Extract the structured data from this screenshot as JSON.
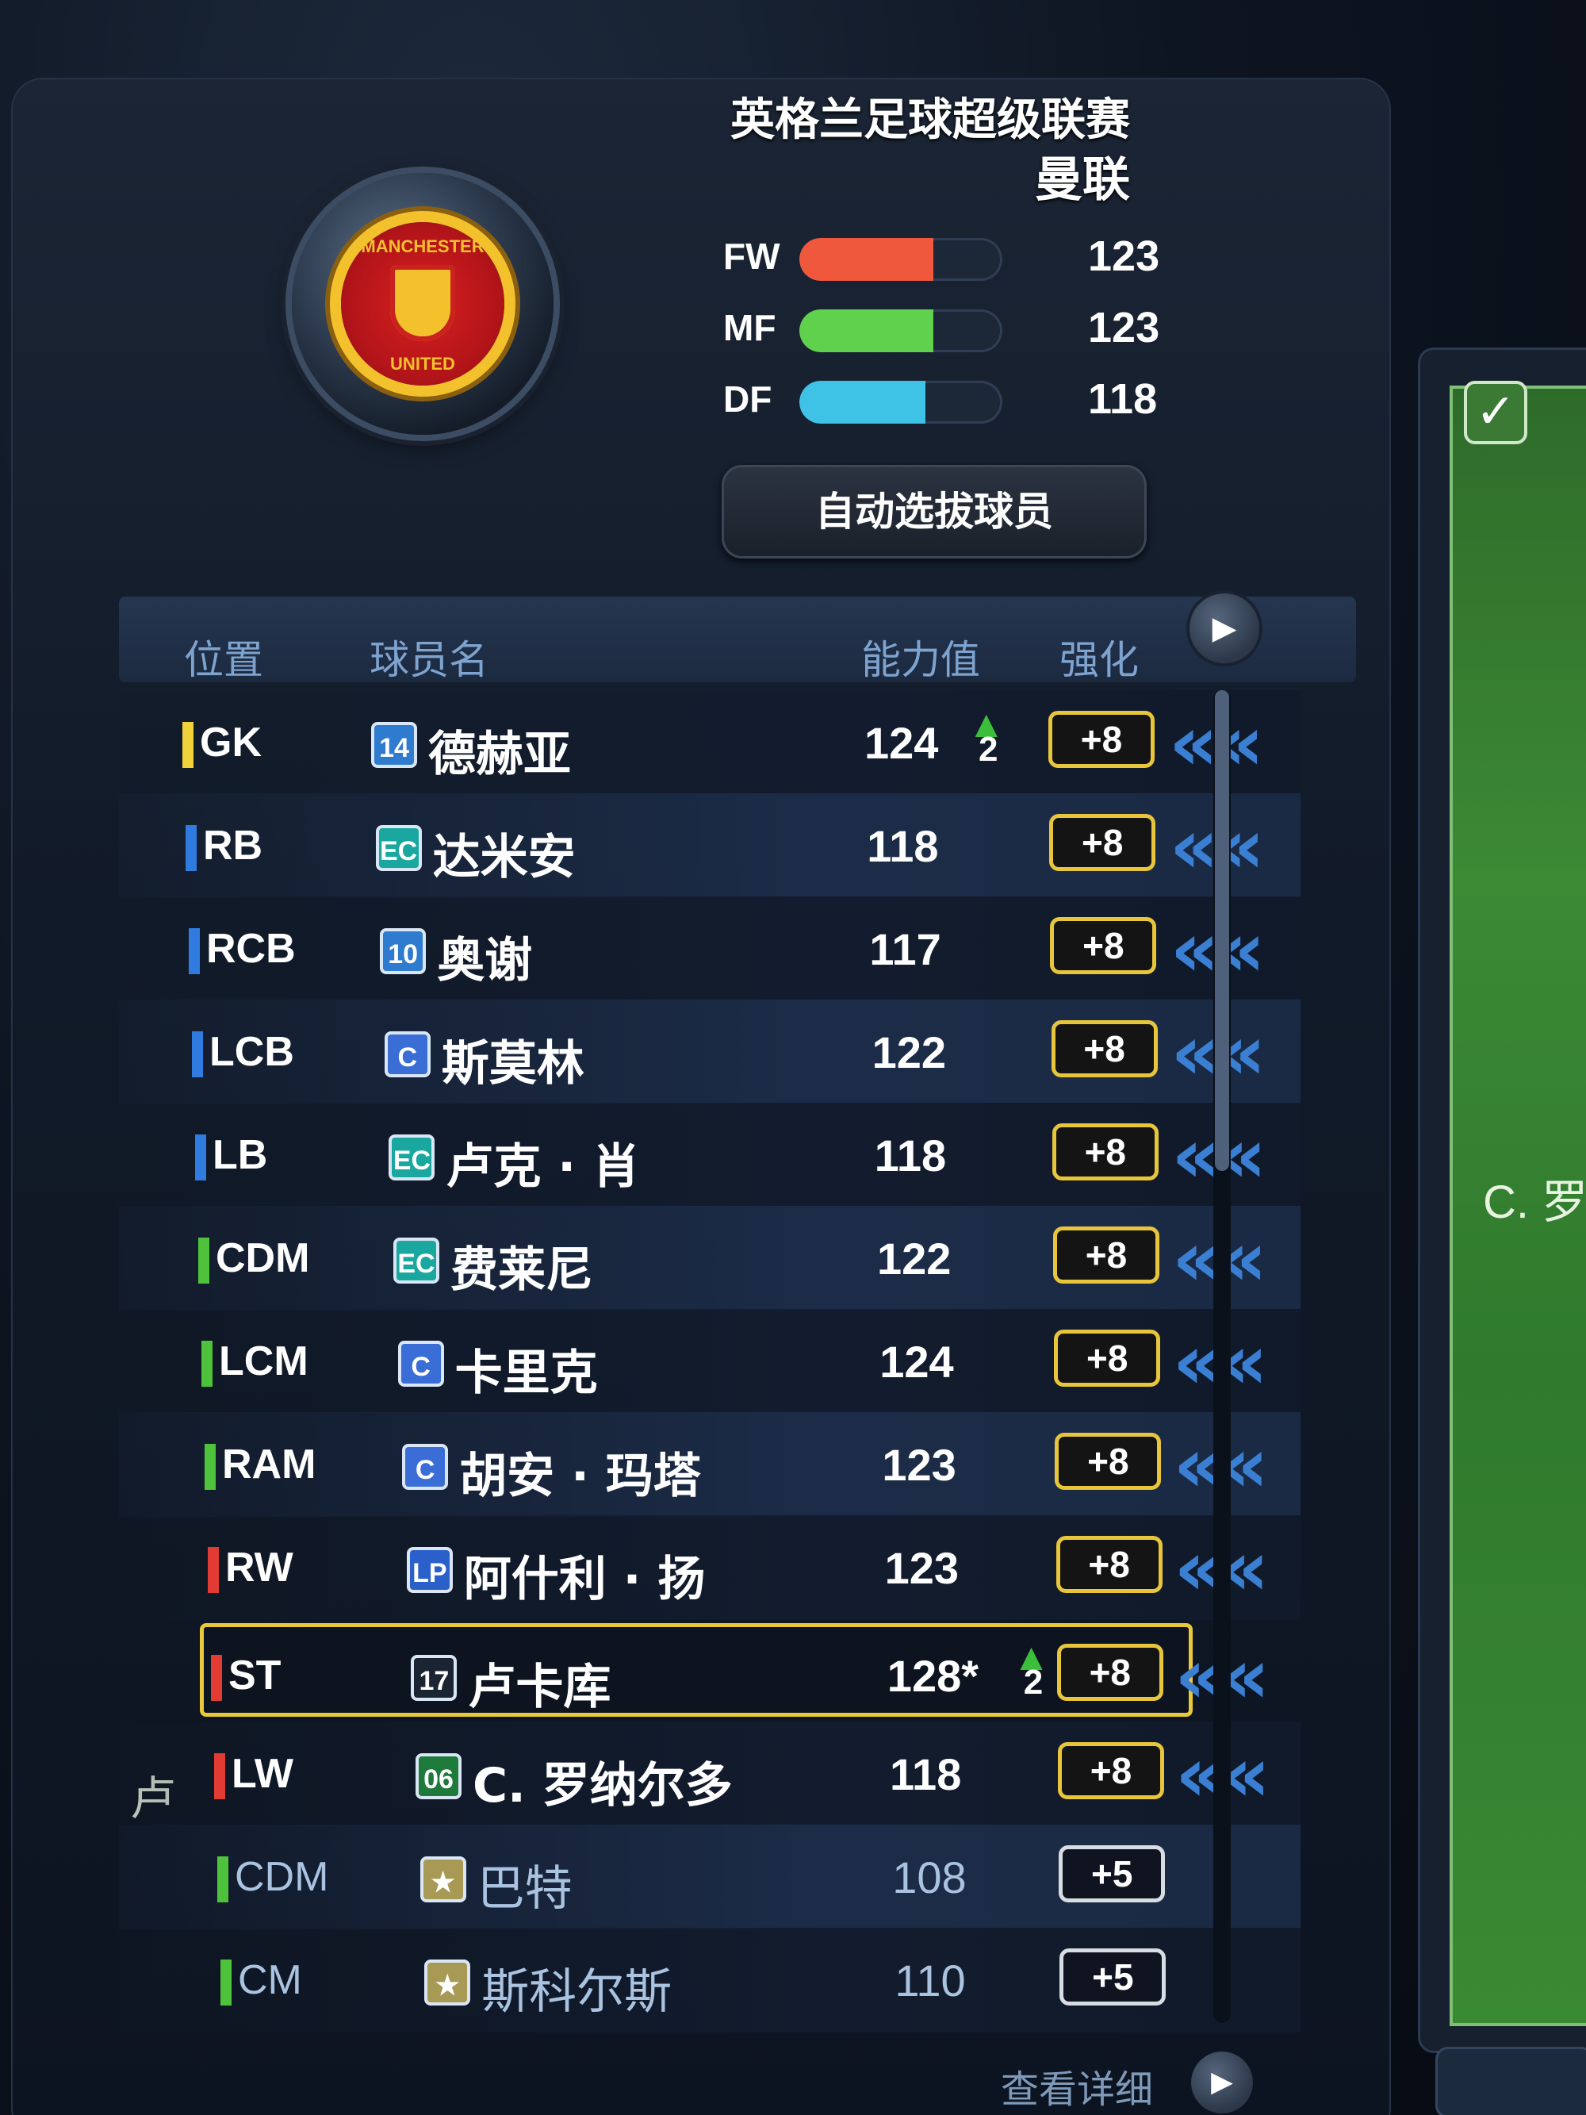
{
  "club": {
    "league": "英格兰足球超级联赛",
    "name": "曼联",
    "crest_top_text": "MANCHESTER",
    "crest_bottom_text": "UNITED"
  },
  "team_stats": [
    {
      "label": "FW",
      "value": "123",
      "fill_fraction": 0.66,
      "color": "#f0583e"
    },
    {
      "label": "MF",
      "value": "123",
      "fill_fraction": 0.66,
      "color": "#5fd14c"
    },
    {
      "label": "DF",
      "value": "118",
      "fill_fraction": 0.62,
      "color": "#3ec3e6"
    }
  ],
  "auto_select_button": "自动选拔球员",
  "table": {
    "headers": {
      "position": "位置",
      "player": "球员名",
      "rating": "能力值",
      "enhance": "强化"
    },
    "rows": [
      {
        "pos": "GK",
        "pos_color": "#f2d23a",
        "badge": "14",
        "badge_color": "#2e7bcf",
        "name": "德赫亚",
        "rating": "124",
        "boost": "2",
        "enhance": "+8",
        "starter": true
      },
      {
        "pos": "RB",
        "pos_color": "#2f7be0",
        "badge": "EC",
        "badge_color": "#1aa7a0",
        "name": "达米安",
        "rating": "118",
        "boost": "",
        "enhance": "+8",
        "starter": true
      },
      {
        "pos": "RCB",
        "pos_color": "#2f7be0",
        "badge": "10",
        "badge_color": "#2e7bcf",
        "name": "奥谢",
        "rating": "117",
        "boost": "",
        "enhance": "+8",
        "starter": true
      },
      {
        "pos": "LCB",
        "pos_color": "#2f7be0",
        "badge": "C",
        "badge_color": "#3a6ed6",
        "name": "斯莫林",
        "rating": "122",
        "boost": "",
        "enhance": "+8",
        "starter": true
      },
      {
        "pos": "LB",
        "pos_color": "#2f7be0",
        "badge": "EC",
        "badge_color": "#1aa7a0",
        "name": "卢克 · 肖",
        "rating": "118",
        "boost": "",
        "enhance": "+8",
        "starter": true
      },
      {
        "pos": "CDM",
        "pos_color": "#4ec23b",
        "badge": "EC",
        "badge_color": "#1aa7a0",
        "name": "费莱尼",
        "rating": "122",
        "boost": "",
        "enhance": "+8",
        "starter": true
      },
      {
        "pos": "LCM",
        "pos_color": "#4ec23b",
        "badge": "C",
        "badge_color": "#3a6ed6",
        "name": "卡里克",
        "rating": "124",
        "boost": "",
        "enhance": "+8",
        "starter": true
      },
      {
        "pos": "RAM",
        "pos_color": "#4ec23b",
        "badge": "C",
        "badge_color": "#3a6ed6",
        "name": "胡安 · 玛塔",
        "rating": "123",
        "boost": "",
        "enhance": "+8",
        "starter": true
      },
      {
        "pos": "RW",
        "pos_color": "#e23b34",
        "badge": "LP",
        "badge_color": "#2b5fc9",
        "name": "阿什利 · 扬",
        "rating": "123",
        "boost": "",
        "enhance": "+8",
        "starter": true
      },
      {
        "pos": "ST",
        "pos_color": "#e23b34",
        "badge": "17",
        "badge_color": "#1b2433",
        "name": "卢卡库",
        "rating": "128*",
        "boost": "2",
        "enhance": "+8",
        "starter": true,
        "selected": true
      },
      {
        "pos": "LW",
        "pos_color": "#e23b34",
        "badge": "06",
        "badge_color": "#1e7a3a",
        "name": "C. 罗纳尔多",
        "rating": "118",
        "boost": "",
        "enhance": "+8",
        "starter": true
      },
      {
        "pos": "CDM",
        "pos_color": "#4ec23b",
        "badge": "★",
        "badge_color": "#a89a55",
        "name": "巴特",
        "rating": "108",
        "boost": "",
        "enhance": "+5",
        "starter": false
      },
      {
        "pos": "CM",
        "pos_color": "#4ec23b",
        "badge": "★",
        "badge_color": "#a89a55",
        "name": "斯科尔斯",
        "rating": "110",
        "boost": "",
        "enhance": "+5",
        "starter": false
      }
    ]
  },
  "view_details": "查看详细",
  "pitch_preview": {
    "player_label": "C. 罗",
    "player_label_2": "卢"
  },
  "icons": {
    "next": "play-triangle-icon",
    "check": "checkmark-icon",
    "boost": "green-up-arrow-icon",
    "swap": "double-chevron-left-icon"
  }
}
